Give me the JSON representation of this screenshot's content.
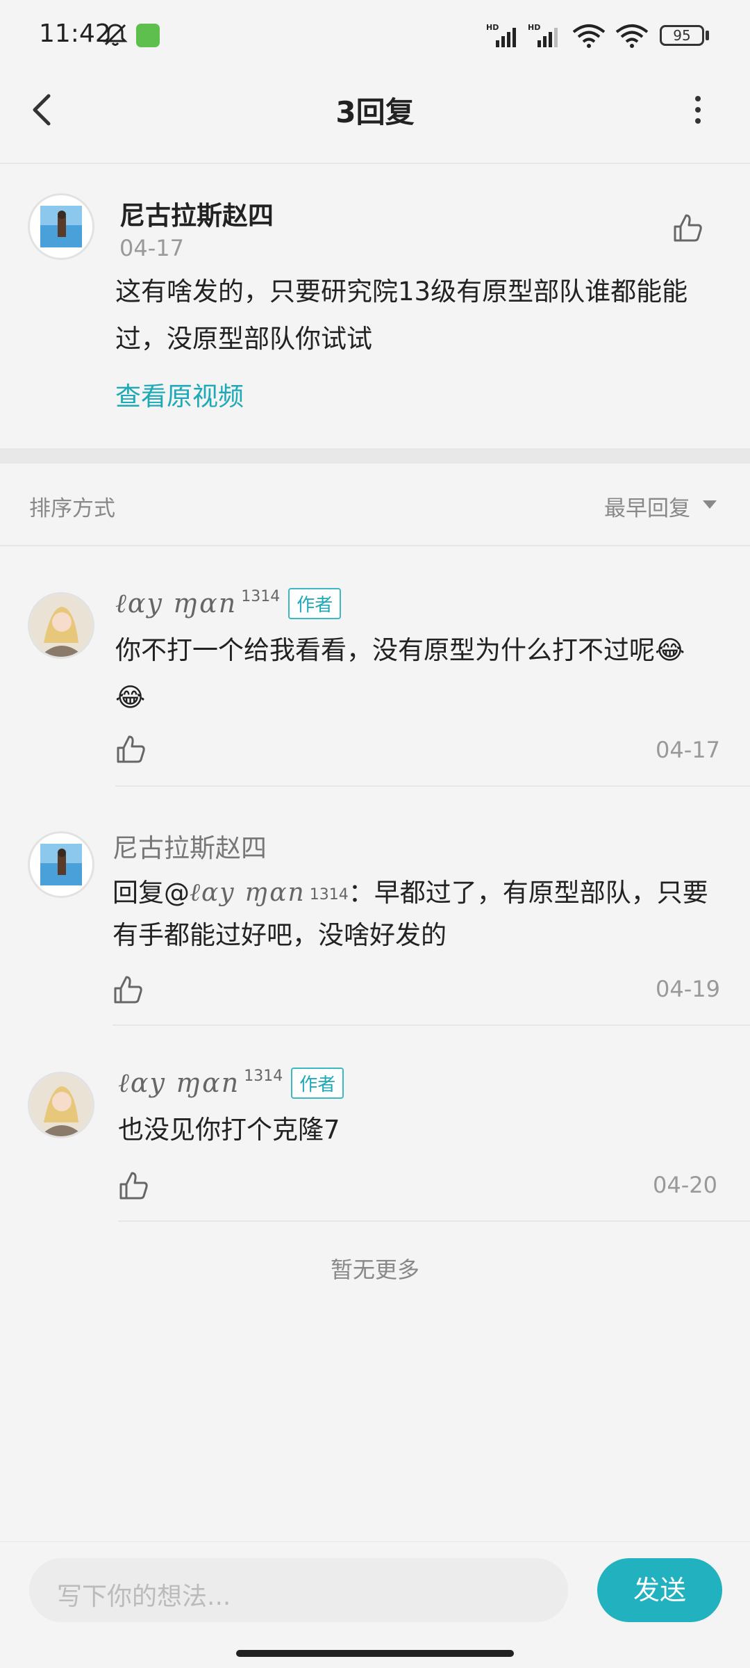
{
  "status_bar": {
    "time": "11:42",
    "battery": "95",
    "net1": "HD",
    "net2": "HD"
  },
  "nav": {
    "title": "3回复"
  },
  "original_comment": {
    "author": "尼古拉斯赵四",
    "date": "04-17",
    "text_line1": "这有啥发的，只要研究院13级有原型部队谁都能能",
    "text_line2": "过，没原型部队你试试",
    "link": "查看原视频"
  },
  "sort": {
    "label": "排序方式",
    "value": "最早回复"
  },
  "replies": [
    {
      "author": "ℓαy ɱαn",
      "author_sup": "1314",
      "tag": "作者",
      "text_line1": "你不打一个给我看看，没有原型为什么打不过呢😂",
      "text_line2": "😂",
      "date": "04-17"
    },
    {
      "author": "尼古拉斯赵四",
      "text_line1_prefix": "回复@",
      "mention": "ℓαy ɱαn",
      "mention_sup": "1314",
      "text_line1_suffix": "：早都过了，有原型部队，只要",
      "text_line2": "有手都能过好吧，没啥好发的",
      "date": "04-19"
    },
    {
      "author": "ℓαy ɱαn",
      "author_sup": "1314",
      "tag": "作者",
      "text_line1": "也没见你打个克隆7",
      "date": "04-20"
    }
  ],
  "footer": {
    "no_more": "暂无更多"
  },
  "composer": {
    "placeholder": "写下你的想法...",
    "send": "发送"
  },
  "colors": {
    "accent": "#21b1bf",
    "link": "#1ea9b8"
  }
}
